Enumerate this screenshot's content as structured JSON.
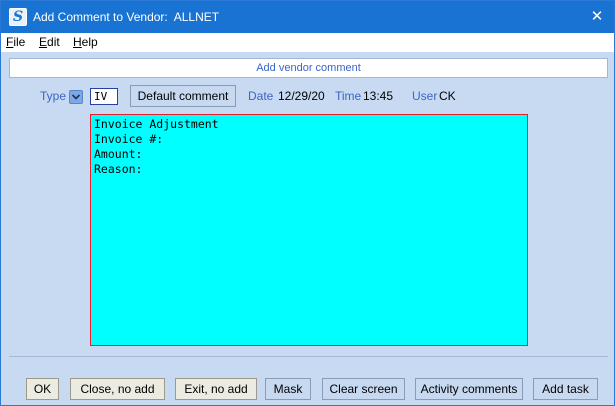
{
  "window": {
    "title": "Add Comment to Vendor:  ALLNET",
    "app_icon_letter": "S"
  },
  "menu": [
    {
      "label": "File",
      "mnemonic": "F",
      "rest": "ile"
    },
    {
      "label": "Edit",
      "mnemonic": "E",
      "rest": "dit"
    },
    {
      "label": "Help",
      "mnemonic": "H",
      "rest": "elp"
    }
  ],
  "header": {
    "title": "Add vendor comment"
  },
  "form": {
    "type_label": "Type",
    "type_value": "IV",
    "default_comment_label": "Default comment",
    "date_label": "Date",
    "date_value": "12/29/20",
    "time_label": "Time",
    "time_value": "13:45",
    "user_label": "User",
    "user_value": "CK",
    "comment_text": "Invoice Adjustment\nInvoice #:\nAmount:\nReason:"
  },
  "buttons": {
    "ok": "OK",
    "close_no_add": "Close, no add",
    "exit_no_add": "Exit, no add",
    "mask": "Mask",
    "clear_screen": "Clear screen",
    "activity_comments": "Activity comments",
    "add_task": "Add task"
  },
  "colors": {
    "titlebar": "#1873d3",
    "client_bg": "#c8daf2",
    "comment_bg": "#00ffff",
    "comment_border": "#e0202a",
    "label_blue": "#3b65c9"
  }
}
